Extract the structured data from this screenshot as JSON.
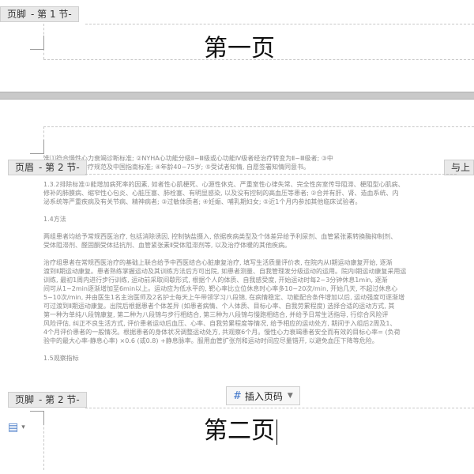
{
  "page1": {
    "footer_tag": {
      "label": "页脚",
      "section": "- 第 1 节-"
    },
    "footer_text": "第一页"
  },
  "page2": {
    "header_tag": {
      "label": "页眉",
      "section": "- 第 2 节-"
    },
    "header_right_tag": "与上",
    "body_lines": [
      "准⑴符合慢性心力衰竭诊断标准; ②NYHA心功能分级Ⅱ~Ⅲ级或心功能Ⅳ级者经治疗转变为Ⅱ~Ⅲ级者; ③中",
      "发现心力衰竭诊疗规范及中国指南标准; ④年龄40~75岁; ⑤受试者知情, 自愿签署知情同意书。",
      "",
      "1.3.2排除标准①能增加病死率的因素, 如者性心肌梗死、心源性休克、严重室性心律失常、完全性房室传导阻滞、梗阻型心肌病、",
      "修补的肺膜病、缩窄性心包炎、心脏压塞、肺栓塞、有明显感染, 以及没有控制的高血压等患者; ②合并有肝、肾、造血系统、内",
      "泌系统等严重疾病及有关节病、精神病者; ③过敏体质者; ④妊娠、哺乳期妇女; ⑤近1个月内参加其他临床试验者。",
      "",
      "1.4方法",
      "",
      "两组患者均给予常规西医治疗, 包括消除诱因, 控制钠盐摄入, 依据疾病类型及个体差异给予利尿剂、血管紧张素转换酶抑制剂、",
      "受体阻滞剂、醛固酮受体拮抗剂、血管紧张素Ⅱ受体阻滞剂等, 以及治疗体暖的其他疾病。",
      "",
      "治疗组患者在常规西医治疗的基础上联合给予中西医结合心脏康复治疗, 填写生活质量评价表, 在院内从Ⅰ期运动康复开始, 逐渐",
      "渡到Ⅱ期运动康复。患者熟练掌握运动及其训练方法后方可出院, 如患者测量、自我管理发分级运动的运用。院内Ⅰ期运动康复采用运",
      "训练, 最初1周内进行步行训练, 运动前采取间歇形式, 根据个人的体质、自我感受度, 开始运动时每2~3分钟休息1min, 逐渐",
      "间可从1~2min逐渐增加至6min以上。运动应为低水平的, 靶心率比立位休息时心率多10~20次/min, 开始几天, 不超过休息心",
      "5~10次/min, 并由医生1名主治医师及2名护士每天上午带领学习八段锦, 在病情稳定、功能配合条件增加以后, 运动强度可逐渐增",
      "可过渡到Ⅱ期运动康复。出院后根据患者个体差异 (如患者病情、个人体质、目标心率、自我劳累程度) 选择合适的运动方式, 其",
      "第一种为单纯八段锦康复, 第二种为八段锦与步行相结合, 第三种为八段锦与慢跑相结合, 并给予日常生活指导, 行综合风险评",
      "风险评估, 纠正不良生活方式, 评价患者运动后血压、心率、自我劳累程度等情况, 给予相应的运动处方, 期间于入组后2周及1、",
      "4个月评价患者的一般情况。根据患者的身体状况调整运动处方, 共观察6个月。慢性心力衰竭患者安全而有效的目标心率= (负荷",
      "验中的最大心率-静息心率) ×0.6 (或0.8) +静息脉率。服用血管扩张剂和运动时间应尽量错开, 以避免血压下降等危险。",
      "",
      "1.5观察指标"
    ],
    "footer_tag": {
      "label": "页脚",
      "section": "- 第 2 节-"
    },
    "insert_page_number": {
      "icon": "页码",
      "label": "插入页码"
    },
    "footer_text": "第二页"
  },
  "colors": {
    "tag_bg": "#e9e9e9",
    "separator": "#c9c9c9",
    "body_text": "#8a8a8a",
    "icon_blue": "#3a72c8"
  }
}
